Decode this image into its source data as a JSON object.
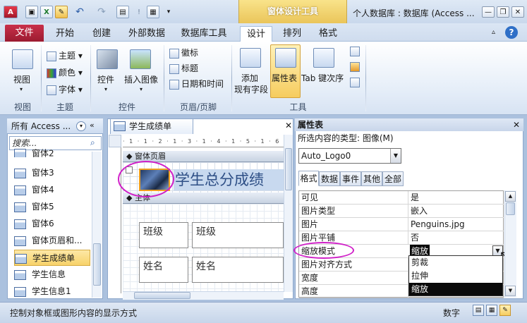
{
  "titlebar": {
    "window_title": "个人数据库 : 数据库 (Access ...",
    "context_tab": "窗体设计工具",
    "qat_icons": [
      "access-app-icon",
      "save-icon",
      "excel-icon",
      "design-view-icon",
      "undo-icon",
      "redo-icon",
      "form-icon",
      "separator-icon",
      "table-icon",
      "customize-icon"
    ],
    "window_buttons": [
      "minimize",
      "restore",
      "close"
    ]
  },
  "ribbon_tabs": {
    "file": "文件",
    "tabs": [
      "开始",
      "创建",
      "外部数据",
      "数据库工具",
      "设计",
      "排列",
      "格式"
    ],
    "active": "设计",
    "help": "?"
  },
  "ribbon": {
    "groups": [
      {
        "label": "视图",
        "items": [
          "视图"
        ]
      },
      {
        "label": "主题",
        "items": [
          "主题",
          "颜色",
          "字体"
        ]
      },
      {
        "label": "控件",
        "items": [
          "控件",
          "插入图像"
        ]
      },
      {
        "label": "页眉/页脚",
        "items": [
          "徽标",
          "标题",
          "日期和时间"
        ]
      },
      {
        "label": "工具",
        "items": [
          "添加现有字段",
          "属性表",
          "Tab 键次序"
        ]
      }
    ],
    "view_label": "视图",
    "theme_label": "主题",
    "color_label": "颜色",
    "font_label": "字体",
    "controls_label": "控件",
    "insert_image_label": "插入图像",
    "logo_label": "徽标",
    "title_label": "标题",
    "datetime_label": "日期和时间",
    "add_field_label_1": "添加",
    "add_field_label_2": "现有字段",
    "property_sheet_label": "属性表",
    "tab_order_label": "Tab 键次序"
  },
  "nav_pane": {
    "header": "所有 Access ...",
    "search_placeholder": "搜索...",
    "items": [
      "窗体2",
      "窗体3",
      "窗体4",
      "窗体5",
      "窗体6",
      "窗体页眉和...",
      "学生成绩单",
      "学生信息",
      "学生信息1"
    ],
    "selected": "学生成绩单"
  },
  "design": {
    "doc_tab": "学生成绩单",
    "ruler": "· 1 · 1 · 2 · 1 · 3 · 1 · 4 · 1 · 5 · 1 · 6 · 1 · 7 ·",
    "header_section": "窗体页眉",
    "detail_section": "主体",
    "title_label": "学生总分成绩",
    "fields": [
      {
        "label": "班级",
        "box": "班级"
      },
      {
        "label": "姓名",
        "box": "姓名"
      }
    ]
  },
  "property_sheet": {
    "title": "属性表",
    "selection_type": "所选内容的类型: 图像(M)",
    "selected_object": "Auto_Logo0",
    "tabs": [
      "格式",
      "数据",
      "事件",
      "其他",
      "全部"
    ],
    "active_tab": "格式",
    "rows": [
      {
        "name": "可见",
        "value": "是"
      },
      {
        "name": "图片类型",
        "value": "嵌入"
      },
      {
        "name": "图片",
        "value": "Penguins.jpg"
      },
      {
        "name": "图片平铺",
        "value": "否"
      },
      {
        "name": "缩放模式",
        "value": "缩放"
      },
      {
        "name": "图片对齐方式",
        "value": ""
      },
      {
        "name": "宽度",
        "value": ""
      },
      {
        "name": "高度",
        "value": ""
      }
    ],
    "dropdown_options": [
      "剪裁",
      "拉伸",
      "缩放"
    ],
    "dropdown_selected": "缩放"
  },
  "statusbar": {
    "text": "控制对象框或图形内容的显示方式",
    "mode": "数字"
  },
  "colors": {
    "file_tab": "#c9304a",
    "context_tab": "#eac55a",
    "highlight": "#d020c8",
    "selection": "#0a0a0a"
  }
}
